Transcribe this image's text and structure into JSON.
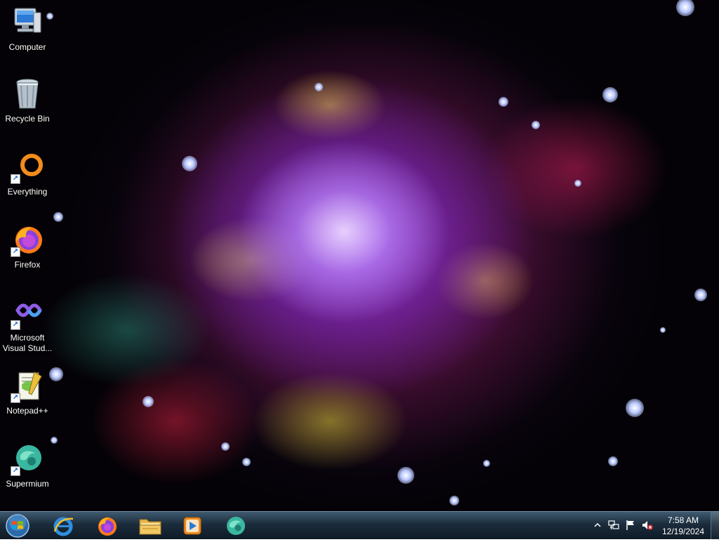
{
  "desktop": {
    "wallpaper": "crab-nebula-wallpaper",
    "icons": [
      {
        "label": "Computer",
        "icon": "computer-icon"
      },
      {
        "label": "Recycle Bin",
        "icon": "recycle-bin-icon"
      },
      {
        "label": "Everything",
        "icon": "everything-search-icon"
      },
      {
        "label": "Firefox",
        "icon": "firefox-icon"
      },
      {
        "label": "Microsoft Visual Stud...",
        "icon": "visual-studio-icon"
      },
      {
        "label": "Notepad++",
        "icon": "notepad-plus-plus-icon"
      },
      {
        "label": "Supermium",
        "icon": "supermium-icon"
      }
    ]
  },
  "taskbar": {
    "start_icon": "windows-start-orb-icon",
    "pinned": [
      {
        "icon": "internet-explorer-icon"
      },
      {
        "icon": "firefox-icon"
      },
      {
        "icon": "file-explorer-icon"
      },
      {
        "icon": "media-player-icon"
      },
      {
        "icon": "supermium-icon"
      }
    ],
    "tray": {
      "icons": [
        "show-hidden-icons-chevron-icon",
        "network-icon",
        "action-center-flag-icon",
        "volume-muted-icon"
      ],
      "time": "7:58 AM",
      "date": "12/19/2024"
    }
  },
  "colors": {
    "taskbar_top": "#3f5a70",
    "taskbar_bottom": "#0f1a26",
    "label_text": "#ffffff"
  }
}
